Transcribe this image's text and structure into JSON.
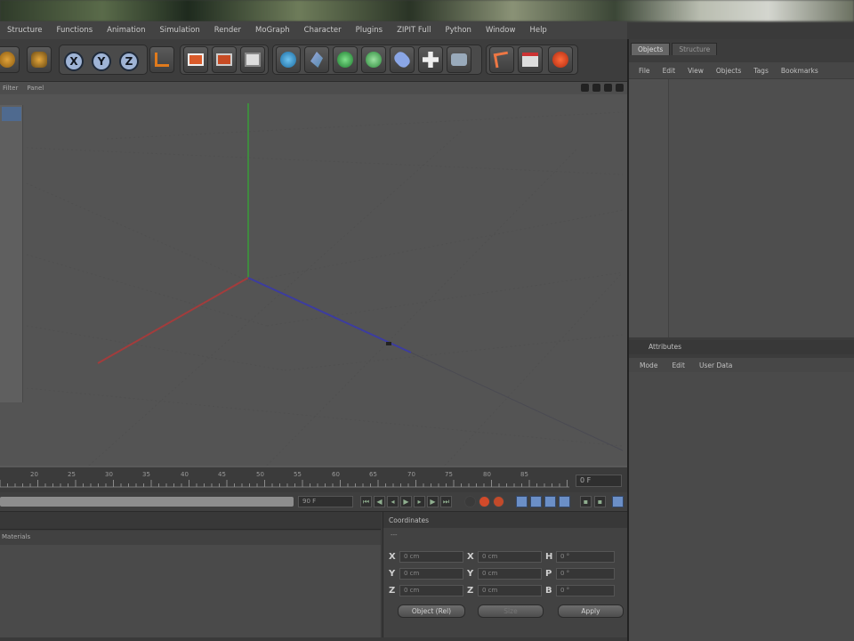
{
  "menubar": [
    "Structure",
    "Functions",
    "Animation",
    "Simulation",
    "Render",
    "MoGraph",
    "Character",
    "Plugins",
    "ZIPIT Full",
    "Python",
    "Window",
    "Help"
  ],
  "viewport": {
    "header_items": [
      "Filter",
      "Panel"
    ]
  },
  "timeline": {
    "ticks": [
      "20",
      "25",
      "30",
      "35",
      "40",
      "45",
      "50",
      "55",
      "60",
      "65",
      "70",
      "75",
      "80",
      "85"
    ],
    "frame_value": "0 F",
    "current_field": "90 F"
  },
  "right_panel": {
    "tabs": [
      "Objects",
      "Structure"
    ],
    "menu": [
      "File",
      "Edit",
      "View",
      "Objects",
      "Tags",
      "Bookmarks"
    ],
    "attributes_title": "Attributes",
    "attributes_menu": [
      "Mode",
      "Edit",
      "User Data"
    ]
  },
  "materials": {
    "sub_label": "Materials"
  },
  "coordinates": {
    "title": "Coordinates",
    "sub": "---",
    "rows": [
      {
        "a": "X",
        "a_val": "0 cm",
        "b": "X",
        "b_val": "0 cm",
        "c": "H",
        "c_val": "0 °"
      },
      {
        "a": "Y",
        "a_val": "0 cm",
        "b": "Y",
        "b_val": "0 cm",
        "c": "P",
        "c_val": "0 °"
      },
      {
        "a": "Z",
        "a_val": "0 cm",
        "b": "Z",
        "b_val": "0 cm",
        "c": "B",
        "c_val": "0 °"
      }
    ],
    "mode_button": "Object (Rel)",
    "size_button": "Size",
    "apply_button": "Apply"
  }
}
